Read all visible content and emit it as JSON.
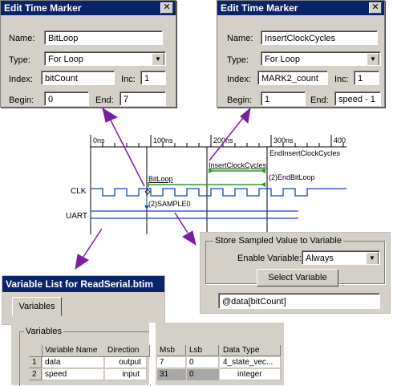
{
  "dialog_left": {
    "title": "Edit Time Marker",
    "name_label": "Name:",
    "name_value": "BitLoop",
    "type_label": "Type:",
    "type_value": "For Loop",
    "index_label": "Index:",
    "index_value": "bitCount",
    "inc_label": "Inc:",
    "inc_value": "1",
    "begin_label": "Begin:",
    "begin_value": "0",
    "end_label": "End:",
    "end_value": "7"
  },
  "dialog_right": {
    "title": "Edit Time Marker",
    "name_label": "Name:",
    "name_value": "InsertClockCycles",
    "type_label": "Type:",
    "type_value": "For Loop",
    "index_label": "Index:",
    "index_value": "MARK2_count",
    "inc_label": "Inc:",
    "inc_value": "1",
    "begin_label": "Begin:",
    "begin_value": "1",
    "end_label": "End:",
    "end_value": "speed - 1"
  },
  "timing": {
    "ticks": [
      "0ns",
      "100ns",
      "200ns",
      "300ns",
      "400"
    ],
    "end_insert_label": "EndInsertClockCycles",
    "insert_label": "InsertClockCycles",
    "end_bitloop_label": "(2)EndBitLoop",
    "bitloop_label": "BitLoop",
    "sample_label": "(2)SAMPLE0",
    "signals": [
      "CLK",
      "UART"
    ]
  },
  "store_panel": {
    "group_label": "Store Sampled Value to Variable",
    "enable_label": "Enable Variable:",
    "enable_value": "Always",
    "select_button": "Select Variable",
    "expression": "@data[bitCount]"
  },
  "variable_list": {
    "title": "Variable List for ReadSerial.btim",
    "tab": "Variables",
    "group_label": "Variables",
    "columns": [
      "Variable Name",
      "Direction",
      "Msb",
      "Lsb",
      "Data Type"
    ],
    "rows": [
      {
        "num": "1",
        "name": "data",
        "direction": "output",
        "msb": "7",
        "lsb": "0",
        "type": "4_state_vec..."
      },
      {
        "num": "2",
        "name": "speed",
        "direction": "input",
        "msb": "31",
        "lsb": "0",
        "type": "integer"
      }
    ]
  },
  "colors": {
    "arrow": "#6a1b9a",
    "titlebar": "#0a246a",
    "clk": "#1a3fd0",
    "marker_green": "#2a9d2a"
  }
}
